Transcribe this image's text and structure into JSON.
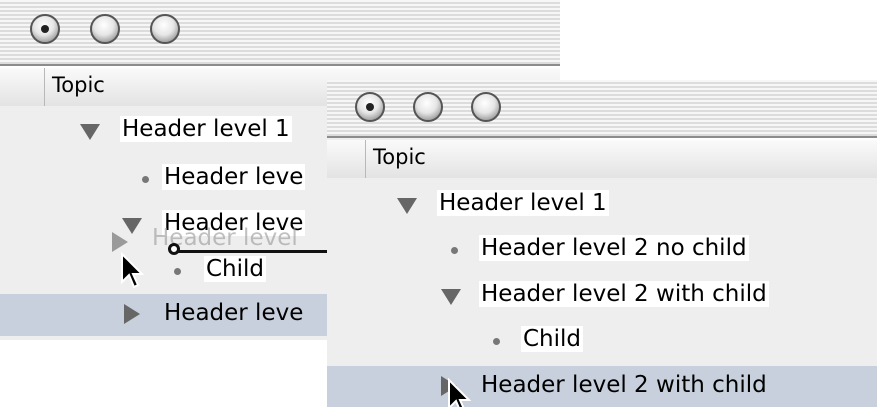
{
  "back_window": {
    "column_header": "Topic",
    "rows": [
      {
        "label": "Header level 1",
        "disclosure": "expanded"
      },
      {
        "label": "Header leve",
        "disclosure": "leaf"
      },
      {
        "label": "Header leve",
        "disclosure": "expanded"
      },
      {
        "label": "Child",
        "disclosure": "leaf"
      },
      {
        "label": "Header leve",
        "disclosure": "collapsed",
        "selected": true
      }
    ],
    "drag_ghost_label": "Header level"
  },
  "front_window": {
    "column_header": "Topic",
    "rows": [
      {
        "label": "Header level 1",
        "disclosure": "expanded"
      },
      {
        "label": "Header level 2 no child",
        "disclosure": "leaf"
      },
      {
        "label": "Header level 2 with child",
        "disclosure": "expanded"
      },
      {
        "label": "Child",
        "disclosure": "leaf"
      },
      {
        "label": "Header level 2 with child",
        "disclosure": "collapsed",
        "selected": true
      }
    ]
  },
  "colors": {
    "selection": "#c7d0dc",
    "disclosure_triangle": "#666666",
    "tree_background": "#eeeeee"
  },
  "icons": [
    "close-button",
    "minimize-button",
    "zoom-button",
    "disclosure-triangle-icon",
    "bullet-icon",
    "arrow-cursor-icon",
    "drop-indicator-icon"
  ]
}
